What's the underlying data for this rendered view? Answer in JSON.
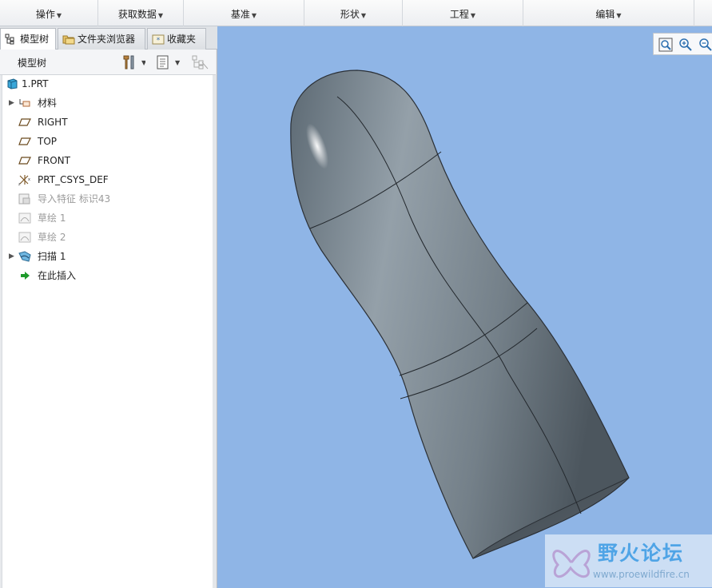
{
  "ribbon": {
    "groups": [
      "操作",
      "获取数据",
      "基准",
      "形状",
      "工程",
      "编辑"
    ]
  },
  "tabs": [
    {
      "label": "模型树",
      "icon": "model-tree-icon",
      "active": true
    },
    {
      "label": "文件夹浏览器",
      "icon": "folder-browser-icon",
      "active": false
    },
    {
      "label": "收藏夹",
      "icon": "favorites-icon",
      "active": false
    }
  ],
  "tree_toolbar": {
    "title": "模型树",
    "icons": [
      "settings-icon",
      "show-icon",
      "filter-icon"
    ]
  },
  "tree": {
    "items": [
      {
        "label": "1.PRT",
        "icon": "part-icon",
        "expandable": false,
        "disabled": false,
        "indent": 0
      },
      {
        "label": "材料",
        "icon": "material-icon",
        "expandable": true,
        "disabled": false,
        "indent": 1
      },
      {
        "label": "RIGHT",
        "icon": "datum-plane-icon",
        "expandable": false,
        "disabled": false,
        "indent": 1
      },
      {
        "label": "TOP",
        "icon": "datum-plane-icon",
        "expandable": false,
        "disabled": false,
        "indent": 1
      },
      {
        "label": "FRONT",
        "icon": "datum-plane-icon",
        "expandable": false,
        "disabled": false,
        "indent": 1
      },
      {
        "label": "PRT_CSYS_DEF",
        "icon": "csys-icon",
        "expandable": false,
        "disabled": false,
        "indent": 1
      },
      {
        "label": "导入特征 标识43",
        "icon": "import-feature-icon",
        "expandable": false,
        "disabled": true,
        "indent": 1
      },
      {
        "label": "草绘 1",
        "icon": "sketch-icon",
        "expandable": false,
        "disabled": true,
        "indent": 1
      },
      {
        "label": "草绘 2",
        "icon": "sketch-icon",
        "expandable": false,
        "disabled": true,
        "indent": 1
      },
      {
        "label": "扫描 1",
        "icon": "sweep-icon",
        "expandable": true,
        "disabled": false,
        "indent": 1
      },
      {
        "label": "在此插入",
        "icon": "insert-here-icon",
        "expandable": false,
        "disabled": false,
        "indent": 1
      }
    ]
  },
  "view_toolbar": {
    "icons": [
      "refit-icon",
      "zoom-in-icon",
      "zoom-out-icon"
    ]
  },
  "watermark": {
    "title": "野火论坛",
    "url": "www.proewildfire.cn"
  },
  "colors": {
    "graphics_background": "#8fb5e6",
    "model_fill": "#7f8c96",
    "model_edge": "#2b3036",
    "watermark_title": "#4fa4e6"
  }
}
